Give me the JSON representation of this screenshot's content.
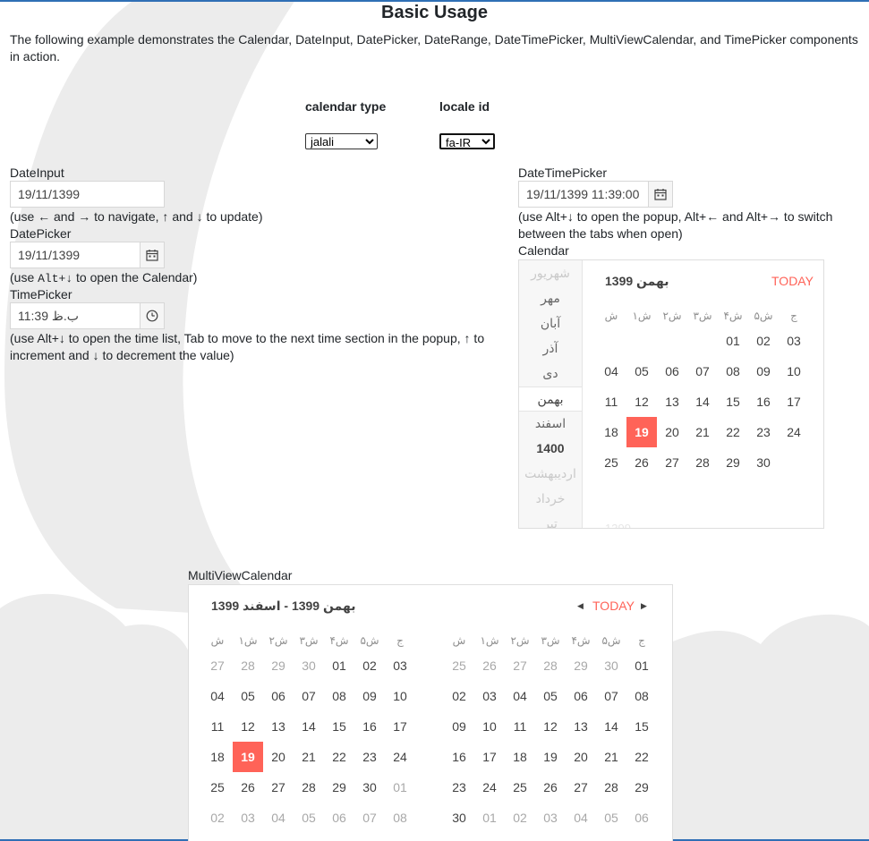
{
  "page": {
    "title": "Basic Usage",
    "description": "The following example demonstrates the Calendar, DateInput, DatePicker, DateRange, DateTimePicker, MultiViewCalendar, and TimePicker components in action."
  },
  "settings": {
    "calendar_type_label": "calendar type",
    "calendar_type_value": "jalali",
    "locale_label": "locale id",
    "locale_value": "fa-IR"
  },
  "date_input": {
    "label": "DateInput",
    "value": "19/11/1399",
    "help": "(use ← and → to navigate, ↑ and ↓ to update)"
  },
  "date_picker": {
    "label": "DatePicker",
    "value": "19/11/1399",
    "help_prefix": "(use ",
    "help_code": "Alt+↓",
    "help_suffix": " to open the Calendar)",
    "button_icon": "calendar-icon"
  },
  "time_picker": {
    "label": "TimePicker",
    "value": "11:39 ب.ظ",
    "help": "(use Alt+↓ to open the time list, Tab to move to the next time section in the popup, ↑ to increment and ↓ to decrement the value)",
    "button_icon": "clock-icon"
  },
  "datetime_picker": {
    "label": "DateTimePicker",
    "value": "19/11/1399 11:39:00",
    "help": "(use Alt+↓ to open the popup, Alt+← and Alt+→ to switch between the tabs when open)",
    "button_icon": "calendar-icon"
  },
  "calendar": {
    "label": "Calendar",
    "title": "بهمن 1399",
    "today": "TODAY",
    "nav_items": [
      {
        "text": "شهریور",
        "state": "dim"
      },
      {
        "text": "مهر",
        "state": ""
      },
      {
        "text": "آبان",
        "state": ""
      },
      {
        "text": "آذر",
        "state": ""
      },
      {
        "text": "دی",
        "state": ""
      },
      {
        "text": "بهمن",
        "state": "selected"
      },
      {
        "text": "اسفند",
        "state": ""
      },
      {
        "text": "1400",
        "state": "year"
      },
      {
        "text": "اردیبهشت",
        "state": "dim"
      },
      {
        "text": "خرداد",
        "state": "dim"
      },
      {
        "text": "تیر",
        "state": "dim"
      }
    ],
    "weekdays": [
      "ش",
      "۱ش",
      "۲ش",
      "۳ش",
      "۴ش",
      "۵ش",
      "ج"
    ],
    "weeks": [
      [
        "",
        "",
        "",
        "",
        "01",
        "02",
        "03"
      ],
      [
        "04",
        "05",
        "06",
        "07",
        "08",
        "09",
        "10"
      ],
      [
        "11",
        "12",
        "13",
        "14",
        "15",
        "16",
        "17"
      ],
      [
        "18",
        "19",
        "20",
        "21",
        "22",
        "23",
        "24"
      ],
      [
        "25",
        "26",
        "27",
        "28",
        "29",
        "30",
        ""
      ]
    ],
    "selected_day": "19",
    "next_title_faded": "1399"
  },
  "multiview": {
    "label": "MultiViewCalendar",
    "title": "بهمن 1399 - اسفند 1399",
    "today": "TODAY",
    "weekdays": [
      "ش",
      "۱ش",
      "۲ش",
      "۳ش",
      "۴ش",
      "۵ش",
      "ج"
    ],
    "left_weeks": [
      [
        "27",
        "28",
        "29",
        "30",
        "01",
        "02",
        "03"
      ],
      [
        "04",
        "05",
        "06",
        "07",
        "08",
        "09",
        "10"
      ],
      [
        "11",
        "12",
        "13",
        "14",
        "15",
        "16",
        "17"
      ],
      [
        "18",
        "19",
        "20",
        "21",
        "22",
        "23",
        "24"
      ],
      [
        "25",
        "26",
        "27",
        "28",
        "29",
        "30",
        "01"
      ],
      [
        "02",
        "03",
        "04",
        "05",
        "06",
        "07",
        "08"
      ]
    ],
    "right_weeks": [
      [
        "25",
        "26",
        "27",
        "28",
        "29",
        "30",
        "01"
      ],
      [
        "02",
        "03",
        "04",
        "05",
        "06",
        "07",
        "08"
      ],
      [
        "09",
        "10",
        "11",
        "12",
        "13",
        "14",
        "15"
      ],
      [
        "16",
        "17",
        "18",
        "19",
        "20",
        "21",
        "22"
      ],
      [
        "23",
        "24",
        "25",
        "26",
        "27",
        "28",
        "29"
      ],
      [
        "30",
        "01",
        "02",
        "03",
        "04",
        "05",
        "06"
      ]
    ],
    "selected_day": "19"
  },
  "colors": {
    "accent": "#ff6358",
    "top_border": "#2f6fb5",
    "background_art": "#ececec"
  }
}
